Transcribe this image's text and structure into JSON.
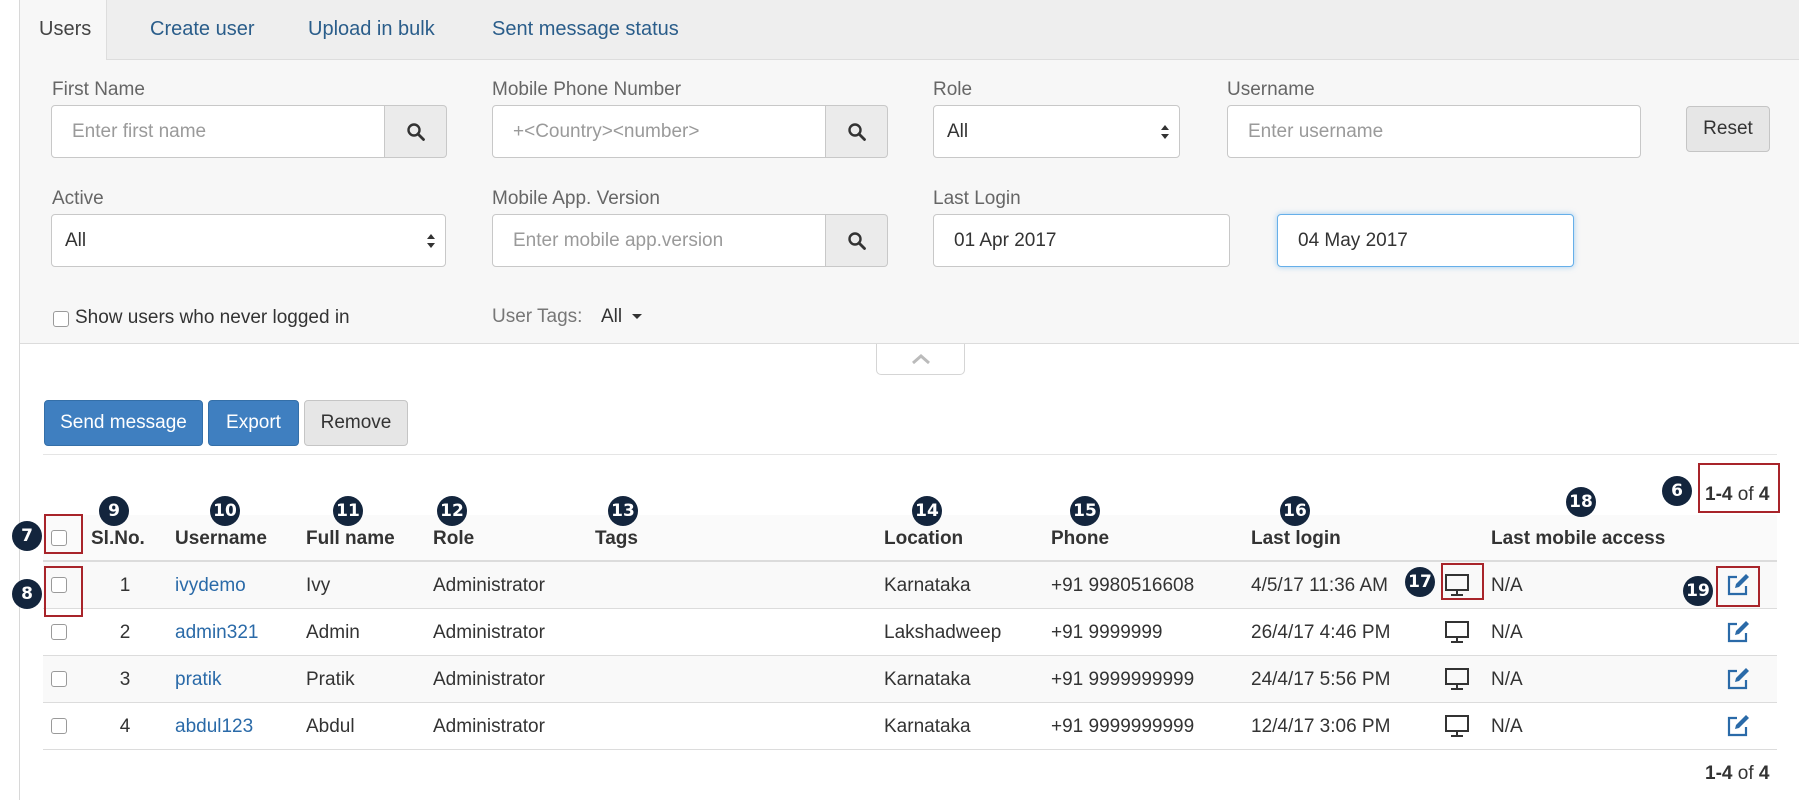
{
  "tabs": [
    {
      "label": "Users"
    },
    {
      "label": "Create user"
    },
    {
      "label": "Upload in bulk"
    },
    {
      "label": "Sent message status"
    }
  ],
  "filters": {
    "first_name": {
      "label": "First Name",
      "placeholder": "Enter first name"
    },
    "mobile_phone": {
      "label": "Mobile Phone Number",
      "placeholder": "+<Country><number>"
    },
    "role": {
      "label": "Role",
      "value": "All"
    },
    "username": {
      "label": "Username",
      "placeholder": "Enter username"
    },
    "reset_label": "Reset",
    "active": {
      "label": "Active",
      "value": "All"
    },
    "mobile_app_version": {
      "label": "Mobile App. Version",
      "placeholder": "Enter mobile app.version"
    },
    "last_login": {
      "label": "Last Login",
      "from": "01 Apr 2017",
      "to": "04 May 2017"
    },
    "never_logged_in_label": "Show users who never logged in",
    "user_tags": {
      "label": "User Tags:",
      "value": "All"
    }
  },
  "actions": {
    "send_message": "Send message",
    "export": "Export",
    "remove": "Remove"
  },
  "pagination": {
    "range": "1-4",
    "of_text": "of",
    "total": "4"
  },
  "table": {
    "columns": {
      "sl_no": "Sl.No.",
      "username": "Username",
      "full_name": "Full name",
      "role": "Role",
      "tags": "Tags",
      "location": "Location",
      "phone": "Phone",
      "last_login": "Last login",
      "last_mobile_access": "Last mobile access"
    },
    "rows": [
      {
        "sl": "1",
        "username": "ivydemo",
        "full_name": "Ivy",
        "role": "Administrator",
        "tags": "",
        "location": "Karnataka",
        "phone": "+91 9980516608",
        "last_login": "4/5/17 11:36 AM",
        "last_mobile_access": "N/A"
      },
      {
        "sl": "2",
        "username": "admin321",
        "full_name": "Admin",
        "role": "Administrator",
        "tags": "",
        "location": "Lakshadweep",
        "phone": "+91 9999999",
        "last_login": "26/4/17 4:46 PM",
        "last_mobile_access": "N/A"
      },
      {
        "sl": "3",
        "username": "pratik",
        "full_name": "Pratik",
        "role": "Administrator",
        "tags": "",
        "location": "Karnataka",
        "phone": "+91 9999999999",
        "last_login": "24/4/17 5:56 PM",
        "last_mobile_access": "N/A"
      },
      {
        "sl": "4",
        "username": "abdul123",
        "full_name": "Abdul",
        "role": "Administrator",
        "tags": "",
        "location": "Karnataka",
        "phone": "+91 9999999999",
        "last_login": "12/4/17 3:06 PM",
        "last_mobile_access": "N/A"
      }
    ]
  },
  "callouts": [
    "6",
    "7",
    "8",
    "9",
    "10",
    "11",
    "12",
    "13",
    "14",
    "15",
    "16",
    "17",
    "18",
    "19"
  ],
  "icons": {
    "search": "search-icon",
    "select": "select-arrows-icon",
    "caret": "caret-down-icon",
    "collapse": "chevron-up-icon",
    "login_source": "desktop-monitor-icon",
    "edit": "edit-icon"
  },
  "colors": {
    "primary_button": "#3f7fc0",
    "link": "#2a6aa8",
    "callout_badge": "#13253d",
    "callout_highlight": "#a8242a"
  }
}
